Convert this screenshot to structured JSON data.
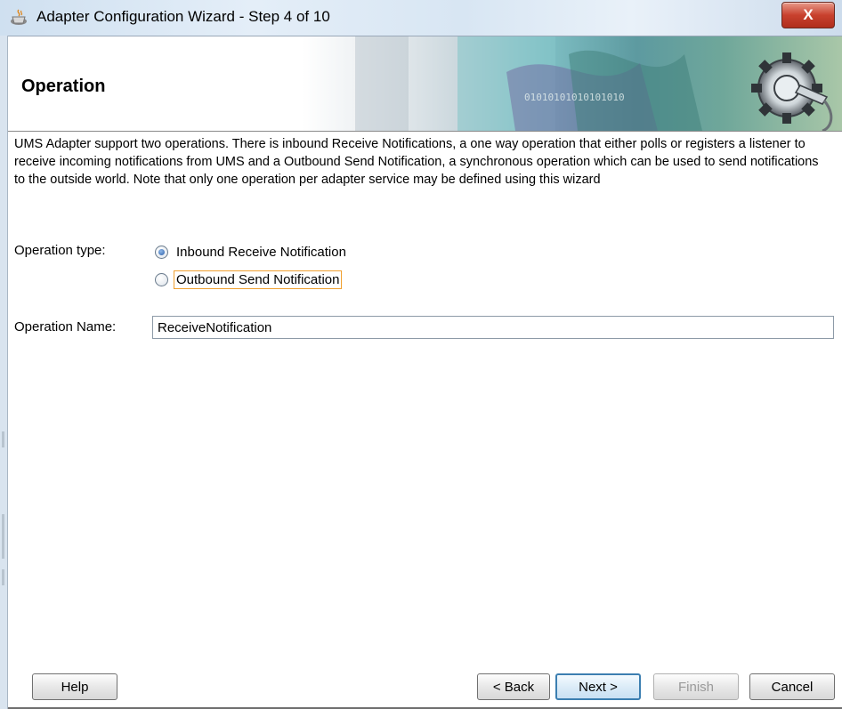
{
  "window": {
    "title": "Adapter Configuration Wizard - Step 4 of 10",
    "close_label": "X"
  },
  "header": {
    "heading": "Operation",
    "banner_text": "01010101010101010"
  },
  "description": "UMS Adapter support two operations. There is inbound Receive Notifications, a one way operation that either polls or registers a listener to receive incoming notifications from UMS and a Outbound Send Notification, a synchronous operation which can be used to send notifications to the outside world. Note that only one operation per adapter service may be defined using this wizard",
  "operation_type": {
    "label": "Operation type:",
    "options": [
      {
        "label": "Inbound Receive Notification",
        "checked": true,
        "mnemonic": "I"
      },
      {
        "label": "Outbound Send Notification",
        "checked": false,
        "mnemonic": "O"
      }
    ]
  },
  "operation_name": {
    "label": "Operation Name:",
    "value": "ReceiveNotification"
  },
  "buttons": {
    "help": "Help",
    "back": "< Back",
    "next": "Next >",
    "finish": "Finish",
    "cancel": "Cancel"
  }
}
